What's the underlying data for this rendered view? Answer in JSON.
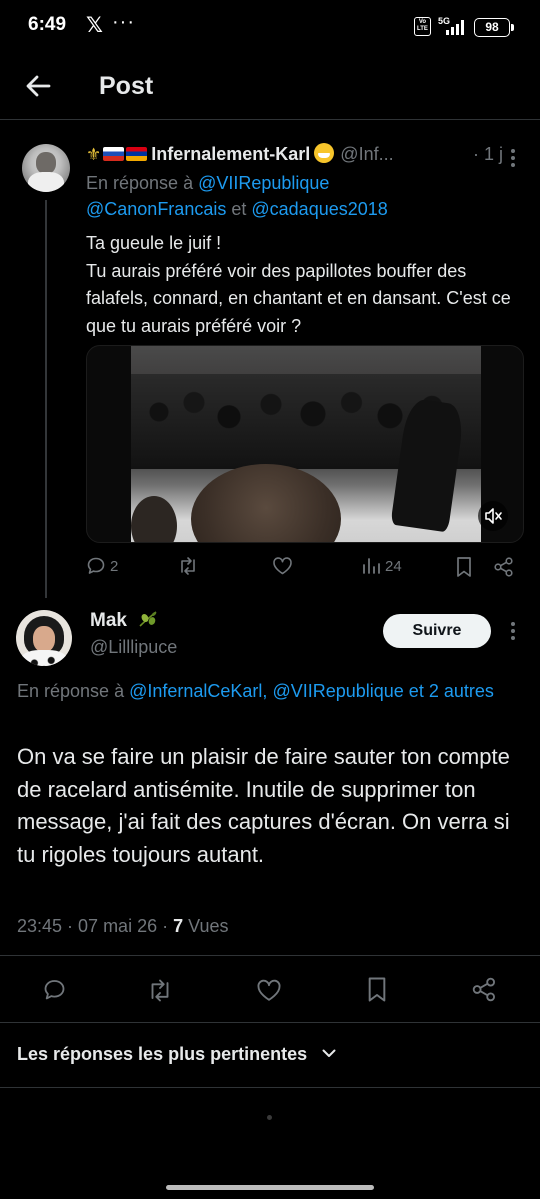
{
  "status_bar": {
    "time": "6:49",
    "x_glyph": "𝕏",
    "dots": "···",
    "volte": "Vo LTE",
    "network": "5G",
    "battery": "98"
  },
  "header": {
    "title": "Post"
  },
  "tweet1": {
    "name_prefix_emoji": "⚜",
    "name": "Infernalement-Karl",
    "handle": "@Inf...",
    "time": "· 1 j",
    "reply_prefix": "En réponse à",
    "reply_mention1": "@VIIRepublique",
    "reply_mention2": "@CanonFrancais",
    "reply_and": "et",
    "reply_mention3": "@cadaques2018",
    "text": "Ta gueule le juif !\nTu aurais préféré voir des papillotes bouffer des falafels, connard, en chantant et en dansant. C'est ce que tu aurais préféré voir ?",
    "stats": {
      "replies": "2",
      "reposts": "",
      "likes": "",
      "views": "24"
    }
  },
  "tweet2": {
    "name": "Mak",
    "handle": "@Lilllipuce",
    "follow_label": "Suivre",
    "reply_prefix": "En réponse à",
    "reply_mention1": "@InfernalCeKarl,",
    "reply_mention2": "@VIIRepublique et 2 autres",
    "text": "On va se faire un plaisir de faire sauter ton compte de racelard antisémite. Inutile de supprimer ton message, j'ai fait des captures d'écran. On verra si tu rigoles toujours autant.",
    "time": "23:45 · 07 mai 26 ·",
    "views_count": "7",
    "views_label": "Vues"
  },
  "sort_label": "Les réponses les plus pertinentes",
  "colors": {
    "accent": "#1d9bf0",
    "muted": "#71767b",
    "text": "#e7e9ea",
    "background": "#000000"
  }
}
